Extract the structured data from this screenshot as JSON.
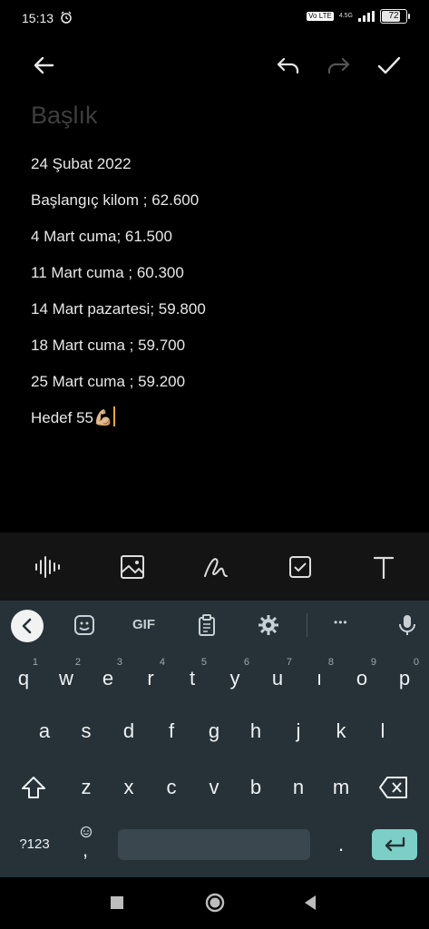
{
  "status_bar": {
    "time": "15:13",
    "volte": "Vo LTE",
    "network": "4.5G",
    "battery": "72"
  },
  "note": {
    "title_placeholder": "Başlık",
    "lines": [
      "24 Şubat 2022",
      "Başlangıç kilom ; 62.600",
      "4 Mart cuma; 61.500",
      "11 Mart cuma ; 60.300",
      "14 Mart pazartesi; 59.800",
      "18 Mart cuma ; 59.700",
      "25 Mart cuma ; 59.200",
      "Hedef 55💪🏼"
    ]
  },
  "keyboard": {
    "toolbar": {
      "gif": "GIF",
      "more": "•••"
    },
    "row1": [
      {
        "k": "q",
        "s": "1"
      },
      {
        "k": "w",
        "s": "2"
      },
      {
        "k": "e",
        "s": "3"
      },
      {
        "k": "r",
        "s": "4"
      },
      {
        "k": "t",
        "s": "5"
      },
      {
        "k": "y",
        "s": "6"
      },
      {
        "k": "u",
        "s": "7"
      },
      {
        "k": "ı",
        "s": "8"
      },
      {
        "k": "o",
        "s": "9"
      },
      {
        "k": "p",
        "s": "0"
      }
    ],
    "row2": [
      "a",
      "s",
      "d",
      "f",
      "g",
      "h",
      "j",
      "k",
      "l"
    ],
    "row3": [
      "z",
      "x",
      "c",
      "v",
      "b",
      "n",
      "m"
    ],
    "symbols": "?123",
    "comma": ",",
    "period": "."
  },
  "icons": {
    "back": "arrow-left-icon",
    "undo": "undo-icon",
    "redo": "redo-icon",
    "done": "check-icon",
    "audio": "waveform-icon",
    "image": "image-icon",
    "draw": "scribble-icon",
    "checklist": "checkbox-icon",
    "text": "text-format-icon"
  },
  "colors": {
    "background": "#000000",
    "keyboard": "#263238",
    "enter_key": "#7ccfc6",
    "caret": "#e9a63a"
  }
}
